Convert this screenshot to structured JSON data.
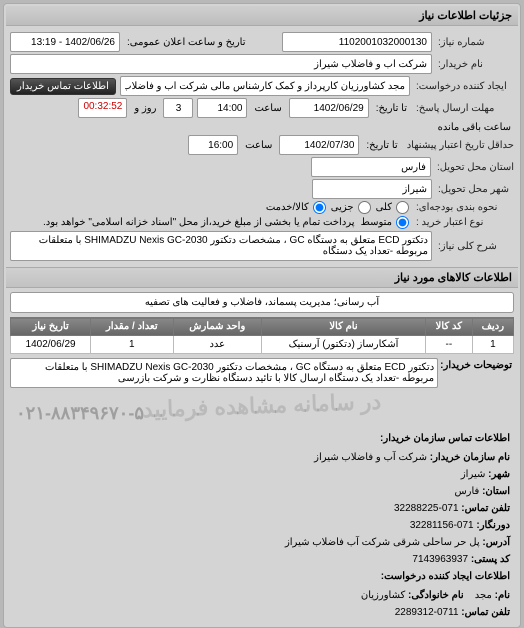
{
  "panel_title": "جزئیات اطلاعات نیاز",
  "labels": {
    "req_no": "شماره نیاز:",
    "pub_datetime": "تاریخ و ساعت اعلان عمومی:",
    "buyer_name": "نام خریدار:",
    "requester": "ایجاد کننده درخواست:",
    "contact_btn": "اطلاعات تماس خریدار",
    "deadline": "تا تاریخ:",
    "time": "ساعت",
    "day": "روز و",
    "remaining": "ساعت باقی مانده",
    "reply_deadline": "مهلت ارسال پاسخ:",
    "supply_deadline": "حداقل تاریخ اعتبار پیشنهاد",
    "validity": "تا تاریخ:",
    "delivery_province": "استان محل تحویل:",
    "delivery_city": "شهر محل تحویل:",
    "budget_row": "نحوه بندی بودجه‌ای:",
    "opt_all": "کلی",
    "opt_was": "جزیی",
    "opt_item": "کالا/خدمت",
    "credit_type": "نوع اعتبار خرید :",
    "opt_related": "متوسط",
    "credit_note": "پرداخت تمام یا بخشی از مبلغ خرید،از محل \"اسناد خزانه اسلامی\" خواهد بود.",
    "main_key": "شرح کلی نیاز:"
  },
  "values": {
    "req_no": "1102001032000130",
    "pub_datetime": "1402/06/26 - 13:19",
    "buyer_name": "شرکت آب و فاضلاب شیراز",
    "requester": "مجد کشاورزیان کارپرداز و کمک کارشناس مالی شرکت آب و فاضلاب شیراز",
    "deadline_date": "1402/06/29",
    "deadline_time": "14:00",
    "days": "3",
    "timer": "00:32:52",
    "validity_date": "1402/07/30",
    "validity_time": "16:00",
    "province": "فارس",
    "city": "شیراز",
    "main_desc": "دتکتور ECD متعلق به دستگاه GC ، مشخصات دتکتور SHIMADZU Nexis GC-2030 با متعلقات مربوطه -تعداد یک دستگاه"
  },
  "section_goods": "اطلاعات کالاهای مورد نیاز",
  "banner": "آب رسانی؛ مدیریت پسماند، فاضلاب و فعالیت های تصفیه",
  "table": {
    "headers": [
      "ردیف",
      "کد کالا",
      "نام کالا",
      "واحد شمارش",
      "تعداد / مقدار",
      "تاریخ نیاز"
    ],
    "row": [
      "1",
      "--",
      "آشکارساز (دتکتور) آرسنیک",
      "عدد",
      "1",
      "1402/06/29"
    ]
  },
  "desc": {
    "label": "توضیحات خریدار:",
    "text": "دتکتور ECD متعلق به دستگاه GC ، مشخصات دتکتور SHIMADZU Nexis GC-2030 با متعلقات مربوطه -تعداد یک دستگاه ارسال کالا با تائید دستگاه نظارت و شرکت بازرسی"
  },
  "watermark": "در سامانه مشاهده فرمایید",
  "contact": {
    "header": "اطلاعات تماس سازمان خریدار:",
    "org_label": "نام سازمان خریدار:",
    "org": "شرکت آب و فاضلاب شیراز",
    "city_label": "شهر:",
    "city": "شیراز",
    "province_label": "استان:",
    "province": "فارس",
    "tel_label": "تلفن تماس:",
    "tel": "071-32288225",
    "fax_label": "دورنگار:",
    "fax": "071-32281156",
    "addr_label": "آدرس:",
    "addr": "پل حر ساحلی شرقی شرکت آب فاضلاب شیراز",
    "post_label": "کد پستی:",
    "post": "7143963937",
    "req_info_header": "اطلاعات ایجاد کننده درخواست:",
    "rep_label": "نام:",
    "rep": "مجد",
    "family_label": "نام خانوادگی:",
    "family": "کشاورزیان",
    "rep_tel_label": "تلفن تماس:",
    "rep_tel": "0711-2289312"
  },
  "big_phone": "۰۲۱-۸۸۳۴۹۶۷۰-۵"
}
